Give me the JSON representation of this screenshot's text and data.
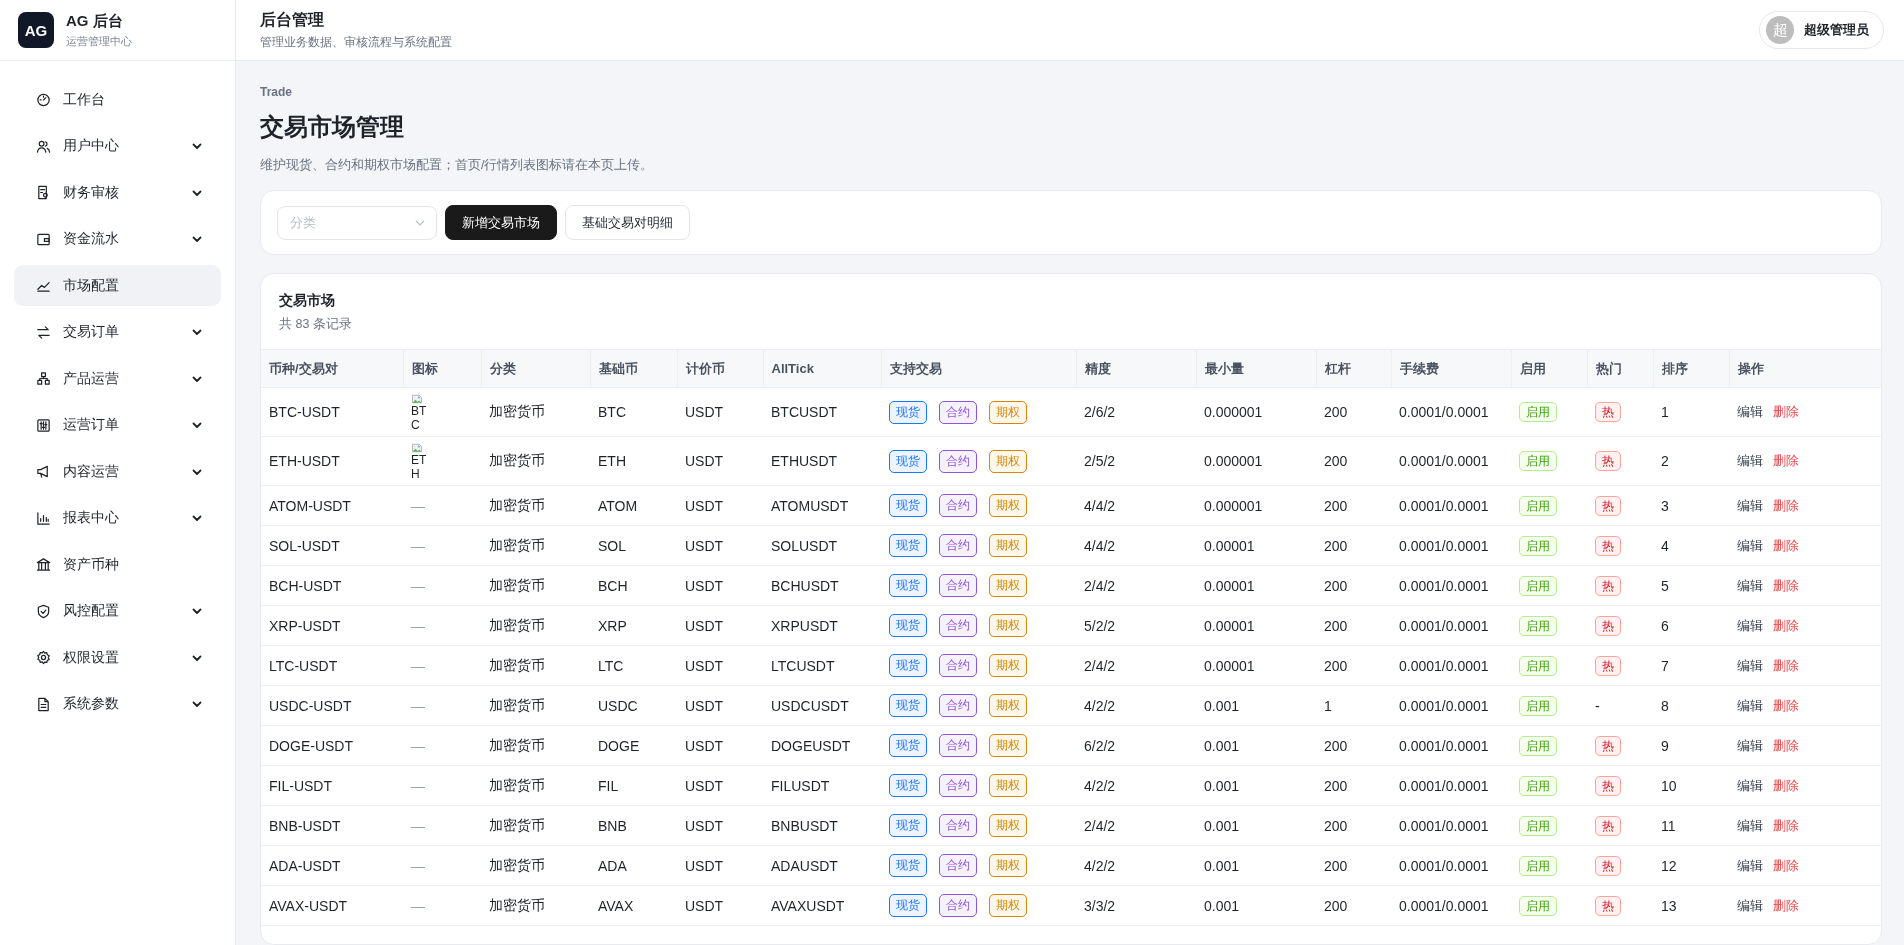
{
  "brand": {
    "logo": "AG",
    "title": "AG 后台",
    "subtitle": "运营管理中心"
  },
  "header": {
    "title": "后台管理",
    "subtitle": "管理业务数据、审核流程与系统配置",
    "user": {
      "avatar": "超",
      "name": "超级管理员"
    }
  },
  "sidebar": {
    "items": [
      {
        "label": "工作台",
        "kind": "link",
        "selected": false
      },
      {
        "label": "用户中心",
        "kind": "group",
        "selected": false
      },
      {
        "label": "财务审核",
        "kind": "group",
        "selected": false
      },
      {
        "label": "资金流水",
        "kind": "group",
        "selected": false
      },
      {
        "label": "市场配置",
        "kind": "link",
        "selected": true
      },
      {
        "label": "交易订单",
        "kind": "group",
        "selected": false
      },
      {
        "label": "产品运营",
        "kind": "group",
        "selected": false
      },
      {
        "label": "运营订单",
        "kind": "group",
        "selected": false
      },
      {
        "label": "内容运营",
        "kind": "group",
        "selected": false
      },
      {
        "label": "报表中心",
        "kind": "group",
        "selected": false
      },
      {
        "label": "资产币种",
        "kind": "link",
        "selected": false
      },
      {
        "label": "风控配置",
        "kind": "group",
        "selected": false
      },
      {
        "label": "权限设置",
        "kind": "group",
        "selected": false
      },
      {
        "label": "系统参数",
        "kind": "group",
        "selected": false
      }
    ]
  },
  "page": {
    "eyebrow": "Trade",
    "title": "交易市场管理",
    "description": "维护现货、合约和期权市场配置；首页/行情列表图标请在本页上传。"
  },
  "toolbar": {
    "category_select": {
      "placeholder": "分类"
    },
    "buttons": [
      {
        "label": "新增交易市场",
        "kind": "primary"
      },
      {
        "label": "基础交易对明细",
        "kind": "secondary"
      }
    ]
  },
  "table": {
    "title": "交易市场",
    "count": "共 83 条记录",
    "columns": [
      "币种/交易对",
      "图标",
      "分类",
      "基础币",
      "计价币",
      "AllTick",
      "支持交易",
      "精度",
      "最小量",
      "杠杆",
      "手续费",
      "启用",
      "热门",
      "排序",
      "操作"
    ],
    "rows": [
      {
        "pair": "BTC-USDT",
        "icon": {
          "kind": "image",
          "text": "BTC"
        },
        "category": "加密货币",
        "base": "BTC",
        "quote": "USDT",
        "alltick": "BTCUSDT",
        "trades": [
          {
            "label": "现货",
            "color": "#1677ff"
          },
          {
            "label": "合约",
            "color": "#9254de"
          },
          {
            "label": "期权",
            "color": "#d48806"
          }
        ],
        "precision": "2/6/2",
        "min": "0.000001",
        "leverage": "200",
        "fee": "0.0001/0.0001",
        "enabled": {
          "label": "启用",
          "on": true
        },
        "hot": {
          "label": "热",
          "on": true
        },
        "sort": "1",
        "actions": [
          {
            "label": "编辑",
            "kind": "edit"
          },
          {
            "label": "删除",
            "kind": "delete"
          }
        ]
      },
      {
        "pair": "ETH-USDT",
        "icon": {
          "kind": "image",
          "text": "ETH"
        },
        "category": "加密货币",
        "base": "ETH",
        "quote": "USDT",
        "alltick": "ETHUSDT",
        "trades": [
          {
            "label": "现货",
            "color": "#1677ff"
          },
          {
            "label": "合约",
            "color": "#9254de"
          },
          {
            "label": "期权",
            "color": "#d48806"
          }
        ],
        "precision": "2/5/2",
        "min": "0.000001",
        "leverage": "200",
        "fee": "0.0001/0.0001",
        "enabled": {
          "label": "启用",
          "on": true
        },
        "hot": {
          "label": "热",
          "on": true
        },
        "sort": "2",
        "actions": [
          {
            "label": "编辑",
            "kind": "edit"
          },
          {
            "label": "删除",
            "kind": "delete"
          }
        ]
      },
      {
        "pair": "ATOM-USDT",
        "icon": {
          "kind": "none",
          "text": "—"
        },
        "category": "加密货币",
        "base": "ATOM",
        "quote": "USDT",
        "alltick": "ATOMUSDT",
        "trades": [
          {
            "label": "现货",
            "color": "#1677ff"
          },
          {
            "label": "合约",
            "color": "#9254de"
          },
          {
            "label": "期权",
            "color": "#d48806"
          }
        ],
        "precision": "4/4/2",
        "min": "0.000001",
        "leverage": "200",
        "fee": "0.0001/0.0001",
        "enabled": {
          "label": "启用",
          "on": true
        },
        "hot": {
          "label": "热",
          "on": true
        },
        "sort": "3",
        "actions": [
          {
            "label": "编辑",
            "kind": "edit"
          },
          {
            "label": "删除",
            "kind": "delete"
          }
        ]
      },
      {
        "pair": "SOL-USDT",
        "icon": {
          "kind": "none",
          "text": "—"
        },
        "category": "加密货币",
        "base": "SOL",
        "quote": "USDT",
        "alltick": "SOLUSDT",
        "trades": [
          {
            "label": "现货",
            "color": "#1677ff"
          },
          {
            "label": "合约",
            "color": "#9254de"
          },
          {
            "label": "期权",
            "color": "#d48806"
          }
        ],
        "precision": "4/4/2",
        "min": "0.00001",
        "leverage": "200",
        "fee": "0.0001/0.0001",
        "enabled": {
          "label": "启用",
          "on": true
        },
        "hot": {
          "label": "热",
          "on": true
        },
        "sort": "4",
        "actions": [
          {
            "label": "编辑",
            "kind": "edit"
          },
          {
            "label": "删除",
            "kind": "delete"
          }
        ]
      },
      {
        "pair": "BCH-USDT",
        "icon": {
          "kind": "none",
          "text": "—"
        },
        "category": "加密货币",
        "base": "BCH",
        "quote": "USDT",
        "alltick": "BCHUSDT",
        "trades": [
          {
            "label": "现货",
            "color": "#1677ff"
          },
          {
            "label": "合约",
            "color": "#9254de"
          },
          {
            "label": "期权",
            "color": "#d48806"
          }
        ],
        "precision": "2/4/2",
        "min": "0.00001",
        "leverage": "200",
        "fee": "0.0001/0.0001",
        "enabled": {
          "label": "启用",
          "on": true
        },
        "hot": {
          "label": "热",
          "on": true
        },
        "sort": "5",
        "actions": [
          {
            "label": "编辑",
            "kind": "edit"
          },
          {
            "label": "删除",
            "kind": "delete"
          }
        ]
      },
      {
        "pair": "XRP-USDT",
        "icon": {
          "kind": "none",
          "text": "—"
        },
        "category": "加密货币",
        "base": "XRP",
        "quote": "USDT",
        "alltick": "XRPUSDT",
        "trades": [
          {
            "label": "现货",
            "color": "#1677ff"
          },
          {
            "label": "合约",
            "color": "#9254de"
          },
          {
            "label": "期权",
            "color": "#d48806"
          }
        ],
        "precision": "5/2/2",
        "min": "0.00001",
        "leverage": "200",
        "fee": "0.0001/0.0001",
        "enabled": {
          "label": "启用",
          "on": true
        },
        "hot": {
          "label": "热",
          "on": true
        },
        "sort": "6",
        "actions": [
          {
            "label": "编辑",
            "kind": "edit"
          },
          {
            "label": "删除",
            "kind": "delete"
          }
        ]
      },
      {
        "pair": "LTC-USDT",
        "icon": {
          "kind": "none",
          "text": "—"
        },
        "category": "加密货币",
        "base": "LTC",
        "quote": "USDT",
        "alltick": "LTCUSDT",
        "trades": [
          {
            "label": "现货",
            "color": "#1677ff"
          },
          {
            "label": "合约",
            "color": "#9254de"
          },
          {
            "label": "期权",
            "color": "#d48806"
          }
        ],
        "precision": "2/4/2",
        "min": "0.00001",
        "leverage": "200",
        "fee": "0.0001/0.0001",
        "enabled": {
          "label": "启用",
          "on": true
        },
        "hot": {
          "label": "热",
          "on": true
        },
        "sort": "7",
        "actions": [
          {
            "label": "编辑",
            "kind": "edit"
          },
          {
            "label": "删除",
            "kind": "delete"
          }
        ]
      },
      {
        "pair": "USDC-USDT",
        "icon": {
          "kind": "none",
          "text": "—"
        },
        "category": "加密货币",
        "base": "USDC",
        "quote": "USDT",
        "alltick": "USDCUSDT",
        "trades": [
          {
            "label": "现货",
            "color": "#1677ff"
          },
          {
            "label": "合约",
            "color": "#9254de"
          },
          {
            "label": "期权",
            "color": "#d48806"
          }
        ],
        "precision": "4/2/2",
        "min": "0.001",
        "leverage": "1",
        "fee": "0.0001/0.0001",
        "enabled": {
          "label": "启用",
          "on": true
        },
        "hot": {
          "label": "-",
          "on": false
        },
        "sort": "8",
        "actions": [
          {
            "label": "编辑",
            "kind": "edit"
          },
          {
            "label": "删除",
            "kind": "delete"
          }
        ]
      },
      {
        "pair": "DOGE-USDT",
        "icon": {
          "kind": "none",
          "text": "—"
        },
        "category": "加密货币",
        "base": "DOGE",
        "quote": "USDT",
        "alltick": "DOGEUSDT",
        "trades": [
          {
            "label": "现货",
            "color": "#1677ff"
          },
          {
            "label": "合约",
            "color": "#9254de"
          },
          {
            "label": "期权",
            "color": "#d48806"
          }
        ],
        "precision": "6/2/2",
        "min": "0.001",
        "leverage": "200",
        "fee": "0.0001/0.0001",
        "enabled": {
          "label": "启用",
          "on": true
        },
        "hot": {
          "label": "热",
          "on": true
        },
        "sort": "9",
        "actions": [
          {
            "label": "编辑",
            "kind": "edit"
          },
          {
            "label": "删除",
            "kind": "delete"
          }
        ]
      },
      {
        "pair": "FIL-USDT",
        "icon": {
          "kind": "none",
          "text": "—"
        },
        "category": "加密货币",
        "base": "FIL",
        "quote": "USDT",
        "alltick": "FILUSDT",
        "trades": [
          {
            "label": "现货",
            "color": "#1677ff"
          },
          {
            "label": "合约",
            "color": "#9254de"
          },
          {
            "label": "期权",
            "color": "#d48806"
          }
        ],
        "precision": "4/2/2",
        "min": "0.001",
        "leverage": "200",
        "fee": "0.0001/0.0001",
        "enabled": {
          "label": "启用",
          "on": true
        },
        "hot": {
          "label": "热",
          "on": true
        },
        "sort": "10",
        "actions": [
          {
            "label": "编辑",
            "kind": "edit"
          },
          {
            "label": "删除",
            "kind": "delete"
          }
        ]
      },
      {
        "pair": "BNB-USDT",
        "icon": {
          "kind": "none",
          "text": "—"
        },
        "category": "加密货币",
        "base": "BNB",
        "quote": "USDT",
        "alltick": "BNBUSDT",
        "trades": [
          {
            "label": "现货",
            "color": "#1677ff"
          },
          {
            "label": "合约",
            "color": "#9254de"
          },
          {
            "label": "期权",
            "color": "#d48806"
          }
        ],
        "precision": "2/4/2",
        "min": "0.001",
        "leverage": "200",
        "fee": "0.0001/0.0001",
        "enabled": {
          "label": "启用",
          "on": true
        },
        "hot": {
          "label": "热",
          "on": true
        },
        "sort": "11",
        "actions": [
          {
            "label": "编辑",
            "kind": "edit"
          },
          {
            "label": "删除",
            "kind": "delete"
          }
        ]
      },
      {
        "pair": "ADA-USDT",
        "icon": {
          "kind": "none",
          "text": "—"
        },
        "category": "加密货币",
        "base": "ADA",
        "quote": "USDT",
        "alltick": "ADAUSDT",
        "trades": [
          {
            "label": "现货",
            "color": "#1677ff"
          },
          {
            "label": "合约",
            "color": "#9254de"
          },
          {
            "label": "期权",
            "color": "#d48806"
          }
        ],
        "precision": "4/2/2",
        "min": "0.001",
        "leverage": "200",
        "fee": "0.0001/0.0001",
        "enabled": {
          "label": "启用",
          "on": true
        },
        "hot": {
          "label": "热",
          "on": true
        },
        "sort": "12",
        "actions": [
          {
            "label": "编辑",
            "kind": "edit"
          },
          {
            "label": "删除",
            "kind": "delete"
          }
        ]
      },
      {
        "pair": "AVAX-USDT",
        "icon": {
          "kind": "none",
          "text": "—"
        },
        "category": "加密货币",
        "base": "AVAX",
        "quote": "USDT",
        "alltick": "AVAXUSDT",
        "trades": [
          {
            "label": "现货",
            "color": "#1677ff"
          },
          {
            "label": "合约",
            "color": "#9254de"
          },
          {
            "label": "期权",
            "color": "#d48806"
          }
        ],
        "precision": "3/3/2",
        "min": "0.001",
        "leverage": "200",
        "fee": "0.0001/0.0001",
        "enabled": {
          "label": "启用",
          "on": true
        },
        "hot": {
          "label": "热",
          "on": true
        },
        "sort": "13",
        "actions": [
          {
            "label": "编辑",
            "kind": "edit"
          },
          {
            "label": "删除",
            "kind": "delete"
          }
        ]
      }
    ]
  }
}
